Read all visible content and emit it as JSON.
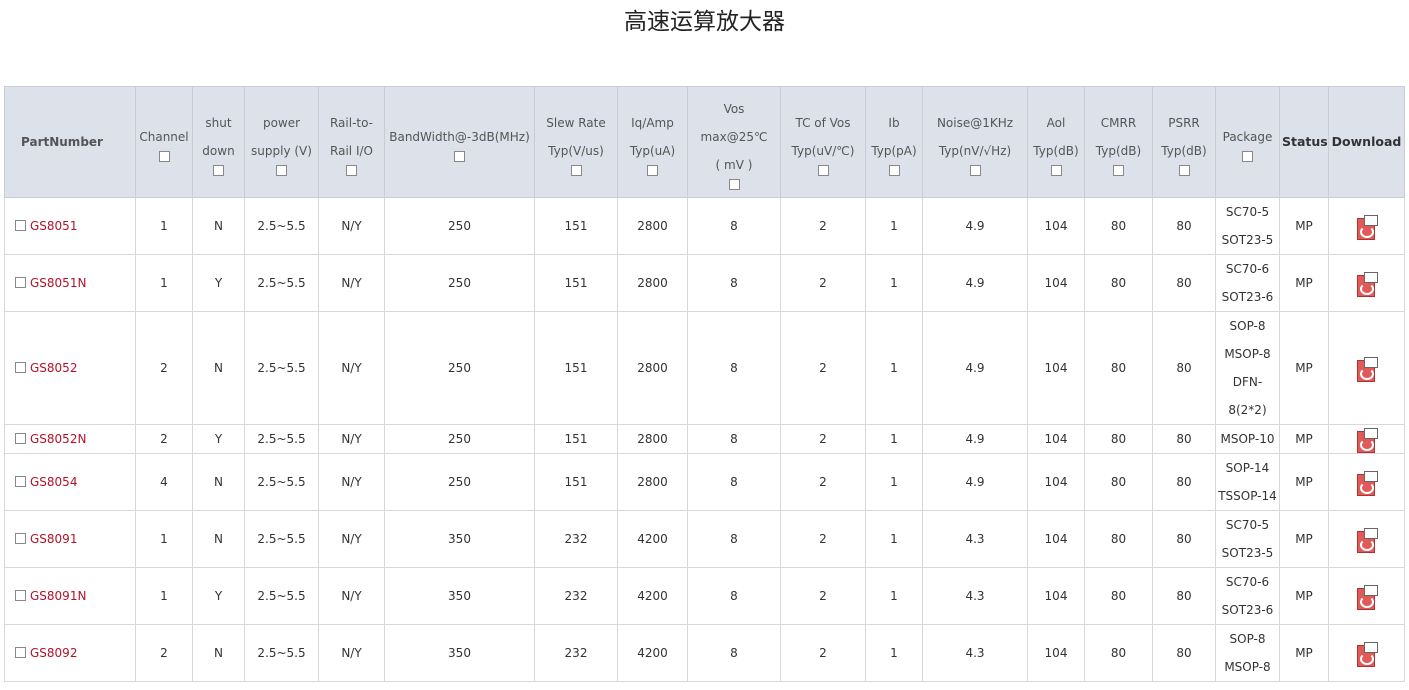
{
  "page": {
    "title": "高速运算放大器"
  },
  "table": {
    "headers": [
      {
        "key": "partnumber",
        "lines": [
          "PartNumber"
        ],
        "checkbox": false,
        "bold": true,
        "part": true
      },
      {
        "key": "channel",
        "lines": [
          "Channel"
        ],
        "checkbox": true
      },
      {
        "key": "shutdown",
        "lines": [
          "shut",
          "down"
        ],
        "checkbox": true
      },
      {
        "key": "power",
        "lines": [
          "power",
          "supply (V)"
        ],
        "checkbox": true
      },
      {
        "key": "railio",
        "lines": [
          "Rail-to-",
          "Rail I/O"
        ],
        "checkbox": true
      },
      {
        "key": "bandwidth",
        "lines": [
          "BandWidth@-3dB(MHz)"
        ],
        "checkbox": true
      },
      {
        "key": "slewrate",
        "lines": [
          "Slew Rate",
          "Typ(V/us)"
        ],
        "checkbox": true
      },
      {
        "key": "iq",
        "lines": [
          "Iq/Amp",
          "Typ(uA)"
        ],
        "checkbox": true
      },
      {
        "key": "vos",
        "lines": [
          "Vos",
          "max@25℃",
          "( mV )"
        ],
        "checkbox": true
      },
      {
        "key": "tcvos",
        "lines": [
          "TC of Vos",
          "Typ(uV/℃)"
        ],
        "checkbox": true
      },
      {
        "key": "ib",
        "lines": [
          "Ib",
          "Typ(pA)"
        ],
        "checkbox": true
      },
      {
        "key": "noise",
        "lines": [
          "Noise@1KHz",
          "Typ(nV/√Hz)"
        ],
        "checkbox": true
      },
      {
        "key": "aol",
        "lines": [
          "Aol",
          "Typ(dB)"
        ],
        "checkbox": true
      },
      {
        "key": "cmrr",
        "lines": [
          "CMRR",
          "Typ(dB)"
        ],
        "checkbox": true
      },
      {
        "key": "psrr",
        "lines": [
          "PSRR",
          "Typ(dB)"
        ],
        "checkbox": true
      },
      {
        "key": "package",
        "lines": [
          "Package"
        ],
        "checkbox": true
      },
      {
        "key": "status",
        "lines": [
          "Status"
        ],
        "checkbox": false,
        "bold": true
      },
      {
        "key": "download",
        "lines": [
          "Download"
        ],
        "checkbox": false,
        "bold": true
      }
    ],
    "download_icon": "pdf-icon",
    "rows": [
      {
        "part": "GS8051",
        "channel": "1",
        "shutdown": "N",
        "power": "2.5~5.5",
        "railio": "N/Y",
        "bandwidth": "250",
        "slewrate": "151",
        "iq": "2800",
        "vos": "8",
        "tcvos": "2",
        "ib": "1",
        "noise": "4.9",
        "aol": "104",
        "cmrr": "80",
        "psrr": "80",
        "package": [
          "SC70-5",
          "SOT23-5"
        ],
        "status": "MP"
      },
      {
        "part": "GS8051N",
        "channel": "1",
        "shutdown": "Y",
        "power": "2.5~5.5",
        "railio": "N/Y",
        "bandwidth": "250",
        "slewrate": "151",
        "iq": "2800",
        "vos": "8",
        "tcvos": "2",
        "ib": "1",
        "noise": "4.9",
        "aol": "104",
        "cmrr": "80",
        "psrr": "80",
        "package": [
          "SC70-6",
          "SOT23-6"
        ],
        "status": "MP"
      },
      {
        "part": "GS8052",
        "channel": "2",
        "shutdown": "N",
        "power": "2.5~5.5",
        "railio": "N/Y",
        "bandwidth": "250",
        "slewrate": "151",
        "iq": "2800",
        "vos": "8",
        "tcvos": "2",
        "ib": "1",
        "noise": "4.9",
        "aol": "104",
        "cmrr": "80",
        "psrr": "80",
        "package": [
          "SOP-8",
          "MSOP-8",
          "DFN-",
          "8(2*2)"
        ],
        "status": "MP"
      },
      {
        "part": "GS8052N",
        "channel": "2",
        "shutdown": "Y",
        "power": "2.5~5.5",
        "railio": "N/Y",
        "bandwidth": "250",
        "slewrate": "151",
        "iq": "2800",
        "vos": "8",
        "tcvos": "2",
        "ib": "1",
        "noise": "4.9",
        "aol": "104",
        "cmrr": "80",
        "psrr": "80",
        "package": [
          "MSOP-10"
        ],
        "status": "MP"
      },
      {
        "part": "GS8054",
        "channel": "4",
        "shutdown": "N",
        "power": "2.5~5.5",
        "railio": "N/Y",
        "bandwidth": "250",
        "slewrate": "151",
        "iq": "2800",
        "vos": "8",
        "tcvos": "2",
        "ib": "1",
        "noise": "4.9",
        "aol": "104",
        "cmrr": "80",
        "psrr": "80",
        "package": [
          "SOP-14",
          "TSSOP-14"
        ],
        "status": "MP"
      },
      {
        "part": "GS8091",
        "channel": "1",
        "shutdown": "N",
        "power": "2.5~5.5",
        "railio": "N/Y",
        "bandwidth": "350",
        "slewrate": "232",
        "iq": "4200",
        "vos": "8",
        "tcvos": "2",
        "ib": "1",
        "noise": "4.3",
        "aol": "104",
        "cmrr": "80",
        "psrr": "80",
        "package": [
          "SC70-5",
          "SOT23-5"
        ],
        "status": "MP"
      },
      {
        "part": "GS8091N",
        "channel": "1",
        "shutdown": "Y",
        "power": "2.5~5.5",
        "railio": "N/Y",
        "bandwidth": "350",
        "slewrate": "232",
        "iq": "4200",
        "vos": "8",
        "tcvos": "2",
        "ib": "1",
        "noise": "4.3",
        "aol": "104",
        "cmrr": "80",
        "psrr": "80",
        "package": [
          "SC70-6",
          "SOT23-6"
        ],
        "status": "MP"
      },
      {
        "part": "GS8092",
        "channel": "2",
        "shutdown": "N",
        "power": "2.5~5.5",
        "railio": "N/Y",
        "bandwidth": "350",
        "slewrate": "232",
        "iq": "4200",
        "vos": "8",
        "tcvos": "2",
        "ib": "1",
        "noise": "4.3",
        "aol": "104",
        "cmrr": "80",
        "psrr": "80",
        "package": [
          "SOP-8",
          "MSOP-8"
        ],
        "status": "MP"
      }
    ]
  }
}
